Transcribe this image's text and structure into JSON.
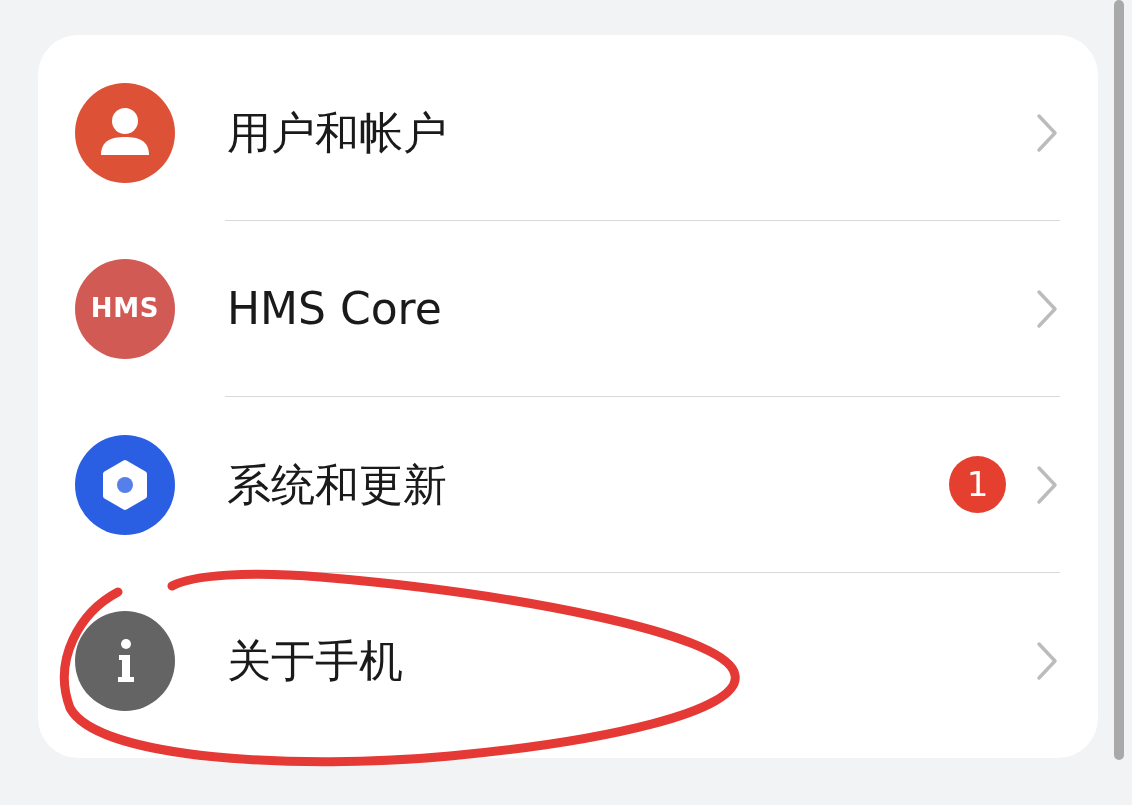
{
  "settings": [
    {
      "label": "用户和帐户",
      "kind": "user",
      "color": "#dd5237"
    },
    {
      "label": "HMS Core",
      "kind": "logo",
      "icon_text": "HMS",
      "color": "#d25a55"
    },
    {
      "label": "系统和更新",
      "kind": "gear",
      "color": "#2b5fe3",
      "badge": "1"
    },
    {
      "label": "关于手机",
      "kind": "info",
      "color": "#646464"
    }
  ]
}
